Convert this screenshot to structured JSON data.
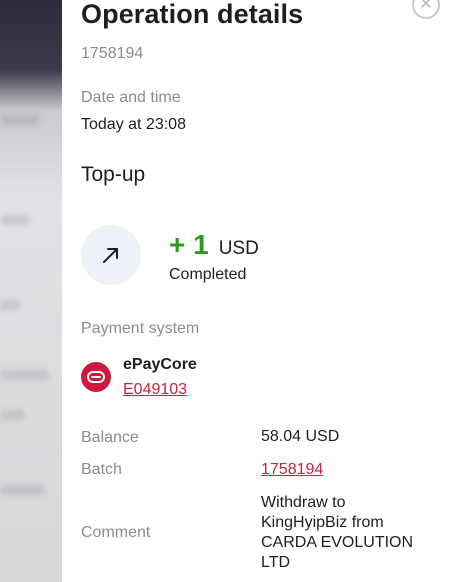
{
  "header": {
    "title": "Operation details",
    "operation_id": "1758194"
  },
  "date_time": {
    "label": "Date and time",
    "value": "Today at 23:08"
  },
  "operation": {
    "type": "Top-up",
    "amount": "+ 1",
    "currency": "USD",
    "status": "Completed",
    "icon": "arrow-up-right-icon"
  },
  "payment_system": {
    "label": "Payment system",
    "name": "ePayCore",
    "account": "E049103",
    "icon": "epaycore-logo-icon"
  },
  "details": {
    "balance_label": "Balance",
    "balance_value": "58.04 USD",
    "batch_label": "Batch",
    "batch_value": "1758194",
    "comment_label": "Comment",
    "comment_value": "Withdraw to KingHyipBiz from CARDA EVOLUTION LTD"
  },
  "colors": {
    "amount_positive": "#2e9a1f",
    "link": "#c5233f",
    "muted": "#8a8c99",
    "brand": "#d0193e"
  }
}
